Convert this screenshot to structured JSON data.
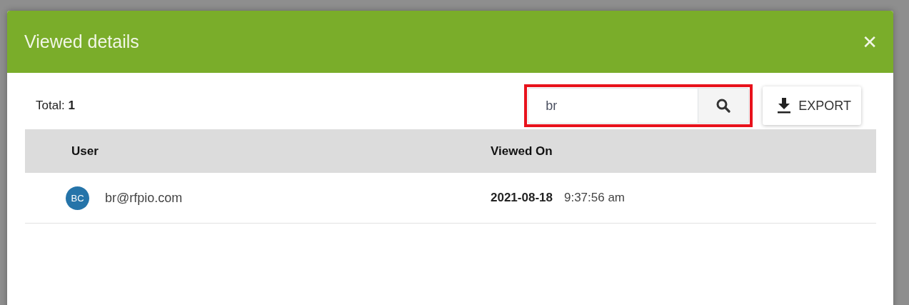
{
  "dialog": {
    "title": "Viewed details",
    "close_label": "✕"
  },
  "toolbar": {
    "total_label": "Total:",
    "total_value": "1",
    "search": {
      "value": "br",
      "highlighted": true
    },
    "export_label": "EXPORT"
  },
  "table": {
    "columns": [
      "User",
      "Viewed On"
    ],
    "rows": [
      {
        "initials": "BC",
        "color": "#2574a9",
        "email": "br@rfpio.com",
        "date": "2021-08-18",
        "time": "9:37:56 am"
      }
    ]
  }
}
